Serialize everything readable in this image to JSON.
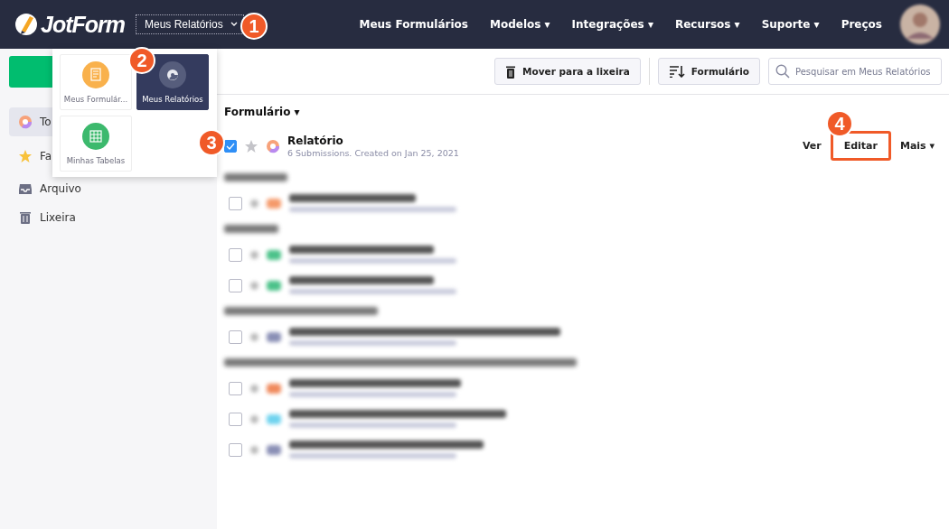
{
  "header": {
    "logo": "JotForm",
    "switcher": "Meus Relatórios",
    "nav": [
      "Meus Formulários",
      "Modelos ▾",
      "Integrações ▾",
      "Recursos ▾",
      "Suporte ▾",
      "Preços"
    ]
  },
  "switcher_menu": [
    {
      "label": "Meus Formulár...",
      "kind": "forms",
      "selected": false
    },
    {
      "label": "Meus Relatórios",
      "kind": "reports",
      "selected": true
    },
    {
      "label": "Minhas Tabelas",
      "kind": "tables",
      "selected": false
    }
  ],
  "sidebar": {
    "items": [
      {
        "label": "To",
        "kind": "reports",
        "selected": true
      },
      {
        "label": "Fa",
        "kind": "star",
        "selected": false
      },
      {
        "label": "Arquivo",
        "kind": "archive",
        "selected": false
      },
      {
        "label": "Lixeira",
        "kind": "trash",
        "selected": false
      }
    ]
  },
  "toolbar": {
    "trash_button": "Mover para a lixeira",
    "sort_button": "Formulário",
    "search": {
      "placeholder": "Pesquisar em Meus Relatórios"
    }
  },
  "group": {
    "title": "Formulário ▾",
    "report": {
      "title": "Relatório",
      "meta": "6 Submissions. Created on Jan 25, 2021",
      "checked": true,
      "starred": false,
      "actions": [
        "Ver",
        "Editar",
        "Mais ▾"
      ]
    }
  },
  "blurred_sections": [
    {
      "rows": [
        {
          "color": "#f59a6b",
          "checked": false
        }
      ]
    },
    {
      "rows": [
        {
          "color": "#4cc28a",
          "checked": false
        },
        {
          "color": "#4cc28a",
          "checked": false
        }
      ]
    },
    {
      "rows": [
        {
          "color": "#8a8fb5",
          "checked": false
        }
      ]
    },
    {
      "rows": [
        {
          "color": "#f08a5d",
          "checked": false
        },
        {
          "color": "#6fd3ef",
          "checked": false
        },
        {
          "color": "#8a8fb5",
          "checked": false
        }
      ]
    }
  ],
  "callouts": [
    "1",
    "2",
    "3",
    "4"
  ]
}
